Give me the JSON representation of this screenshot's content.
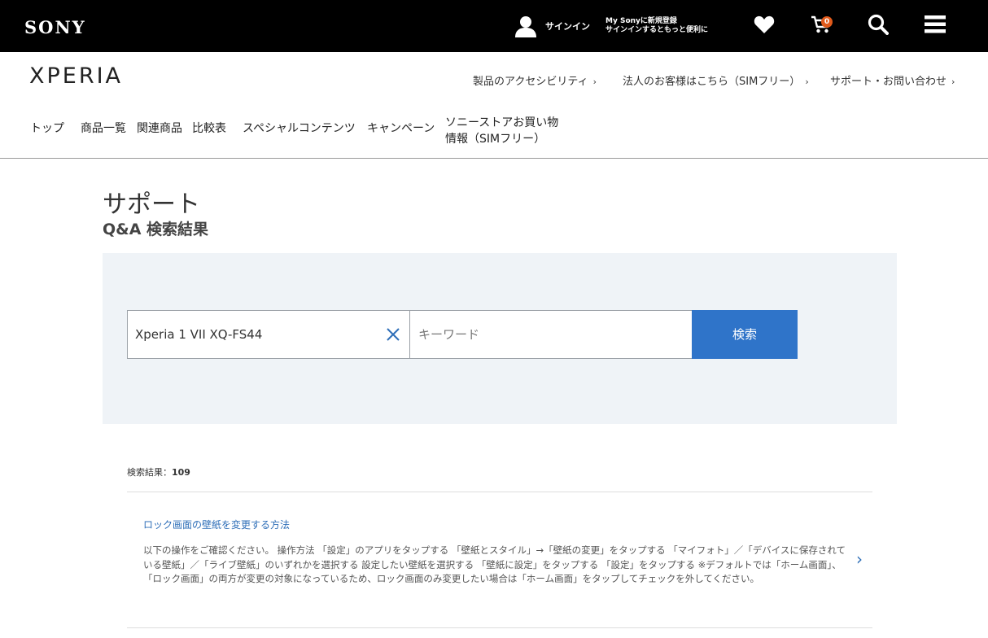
{
  "topbar": {
    "brand": "SONY",
    "signin_label": "サインイン",
    "mysony_line1": "My Sonyに新規登録",
    "mysony_line2": "サインインするともっと便利に",
    "cart_count": "0",
    "icons": [
      "user-icon",
      "heart-icon",
      "cart-icon",
      "search-icon",
      "menu-icon"
    ]
  },
  "header": {
    "logo": "XPERIA",
    "util_links": [
      "製品のアクセシビリティ",
      "法人のお客様はこちら（SIMフリー）",
      "サポート・お問い合わせ"
    ]
  },
  "nav": {
    "items": [
      "トップ",
      "商品一覧",
      "関連商品",
      "比較表",
      "スペシャルコンテンツ",
      "キャンペーン"
    ],
    "store_line1": "ソニーストアお買い物",
    "store_line2": "情報（SIMフリー）"
  },
  "page": {
    "title": "サポート",
    "subtitle": "Q&A 検索結果"
  },
  "search": {
    "product_value": "Xperia 1 VII XQ-FS44",
    "keyword_placeholder": "キーワード",
    "button_label": "検索"
  },
  "results": {
    "count_label": "検索結果：",
    "count": "109",
    "items": [
      {
        "title": "ロック画面の壁紙を変更する方法",
        "body": "以下の操作をご確認ください。 操作方法 「設定」のアプリをタップする 「壁紙とスタイル」→「壁紙の変更」をタップする 「マイフォト」／「デバイスに保存されている壁紙」／「ライブ壁紙」のいずれかを選択する 設定したい壁紙を選択する 「壁紙に設定」をタップする 「設定」をタップする ※デフォルトでは「ホーム画面」、「ロック画面」の両方が変更の対象になっているため、ロック画面のみ変更したい場合は「ホーム画面」をタップしてチェックを外してください。"
      }
    ]
  },
  "colors": {
    "topbar_bg": "#000000",
    "accent_blue": "#2f74c9",
    "panel_bg": "#eff3f7",
    "badge": "#e05a1b"
  }
}
